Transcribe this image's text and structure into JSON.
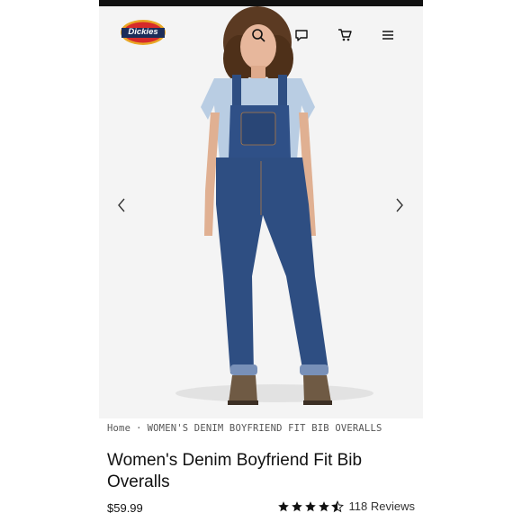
{
  "brand": {
    "logo_text": "Dickies"
  },
  "header": {
    "icons": [
      "search-icon",
      "chat-icon",
      "cart-icon",
      "menu-icon"
    ]
  },
  "gallery": {
    "prev_icon": "chevron-left-icon",
    "next_icon": "chevron-right-icon"
  },
  "breadcrumb": {
    "home": "Home",
    "separator": "·",
    "current": "WOMEN'S DENIM BOYFRIEND FIT BIB OVERALLS"
  },
  "product": {
    "title": "Women's Denim Boyfriend Fit Bib Overalls",
    "price": "$59.99",
    "rating": 4.5,
    "reviews": "118 Reviews"
  },
  "colors": {
    "denim": "#2e4e82",
    "shirt": "#b9cde3",
    "boots": "#6f5a44",
    "logo_red": "#d62a2a",
    "logo_navy": "#1c2d5a",
    "logo_gold": "#e9a726"
  }
}
